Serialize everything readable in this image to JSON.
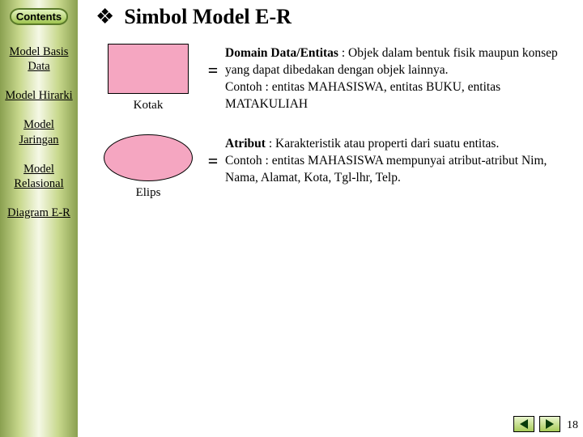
{
  "sidebar": {
    "contents_label": "Contents",
    "items": [
      "Model Basis Data",
      "Model Hirarki",
      "Model Jaringan",
      "Model Relasional",
      "Diagram E-R"
    ]
  },
  "title": {
    "bullet": "❖",
    "text": "Simbol Model E-R"
  },
  "symbols": [
    {
      "shape_label": "Kotak",
      "eq": "=",
      "term": "Domain Data/Entitas",
      "body": " : Objek dalam bentuk fisik maupun konsep  yang dapat dibedakan dengan objek lainnya.",
      "example": "Contoh : entitas MAHASISWA, entitas BUKU, entitas MATAKULIAH"
    },
    {
      "shape_label": "Elips",
      "eq": "=",
      "term": "Atribut",
      "body": " : Karakteristik atau properti dari suatu entitas.",
      "example": "Contoh : entitas MAHASISWA mempunyai atribut-atribut Nim, Nama, Alamat, Kota, Tgl-lhr, Telp."
    }
  ],
  "page_number": "18"
}
